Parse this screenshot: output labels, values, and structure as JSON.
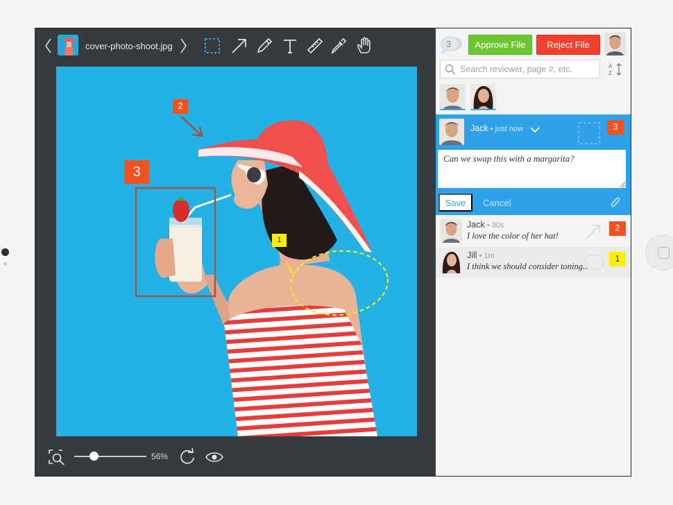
{
  "editor": {
    "file_name": "cover-photo-shoot.jpg",
    "zoom_label": "56%",
    "zoom_level_fraction": 0.27,
    "tools": [
      "selection-tool-icon",
      "arrow-tool-icon",
      "pencil-tool-icon",
      "text-tool-icon",
      "ruler-tool-icon",
      "eyedropper-tool-icon",
      "hand-tool-icon"
    ],
    "annotations": [
      {
        "number": "2",
        "shape": "arrow",
        "color": "#f1511f"
      },
      {
        "number": "3",
        "shape": "rectangle",
        "color": "#f1511f"
      },
      {
        "number": "1",
        "shape": "ellipse",
        "color": "#fdee0a"
      }
    ]
  },
  "panel": {
    "comment_count": "3",
    "approve_label": "Approve File",
    "reject_label": "Reject File",
    "search_placeholder": "Search reviewer, page #, etc.",
    "active_comment": {
      "author": "Jack",
      "time": " • just now",
      "badge": "3",
      "text": "Can we swap this with a margarita?",
      "save_label": "Save",
      "cancel_label": "Cancel"
    },
    "comments": [
      {
        "author": "Jack",
        "time": " • 30s",
        "text": "I love the color of her hat!",
        "badge": "2",
        "badge_color": "#f1511f"
      },
      {
        "author": "Jill",
        "time": " • 1m",
        "text": "I think we should consider toning...",
        "badge": "1",
        "badge_color": "#fdee0a"
      }
    ]
  },
  "colors": {
    "accent_blue": "#2fa1eb",
    "approve_green": "#6cc531",
    "reject_red": "#f1402b",
    "canvas_blue": "#23b1e6",
    "annotation_orange": "#f1511f",
    "annotation_yellow": "#fdee0a"
  }
}
